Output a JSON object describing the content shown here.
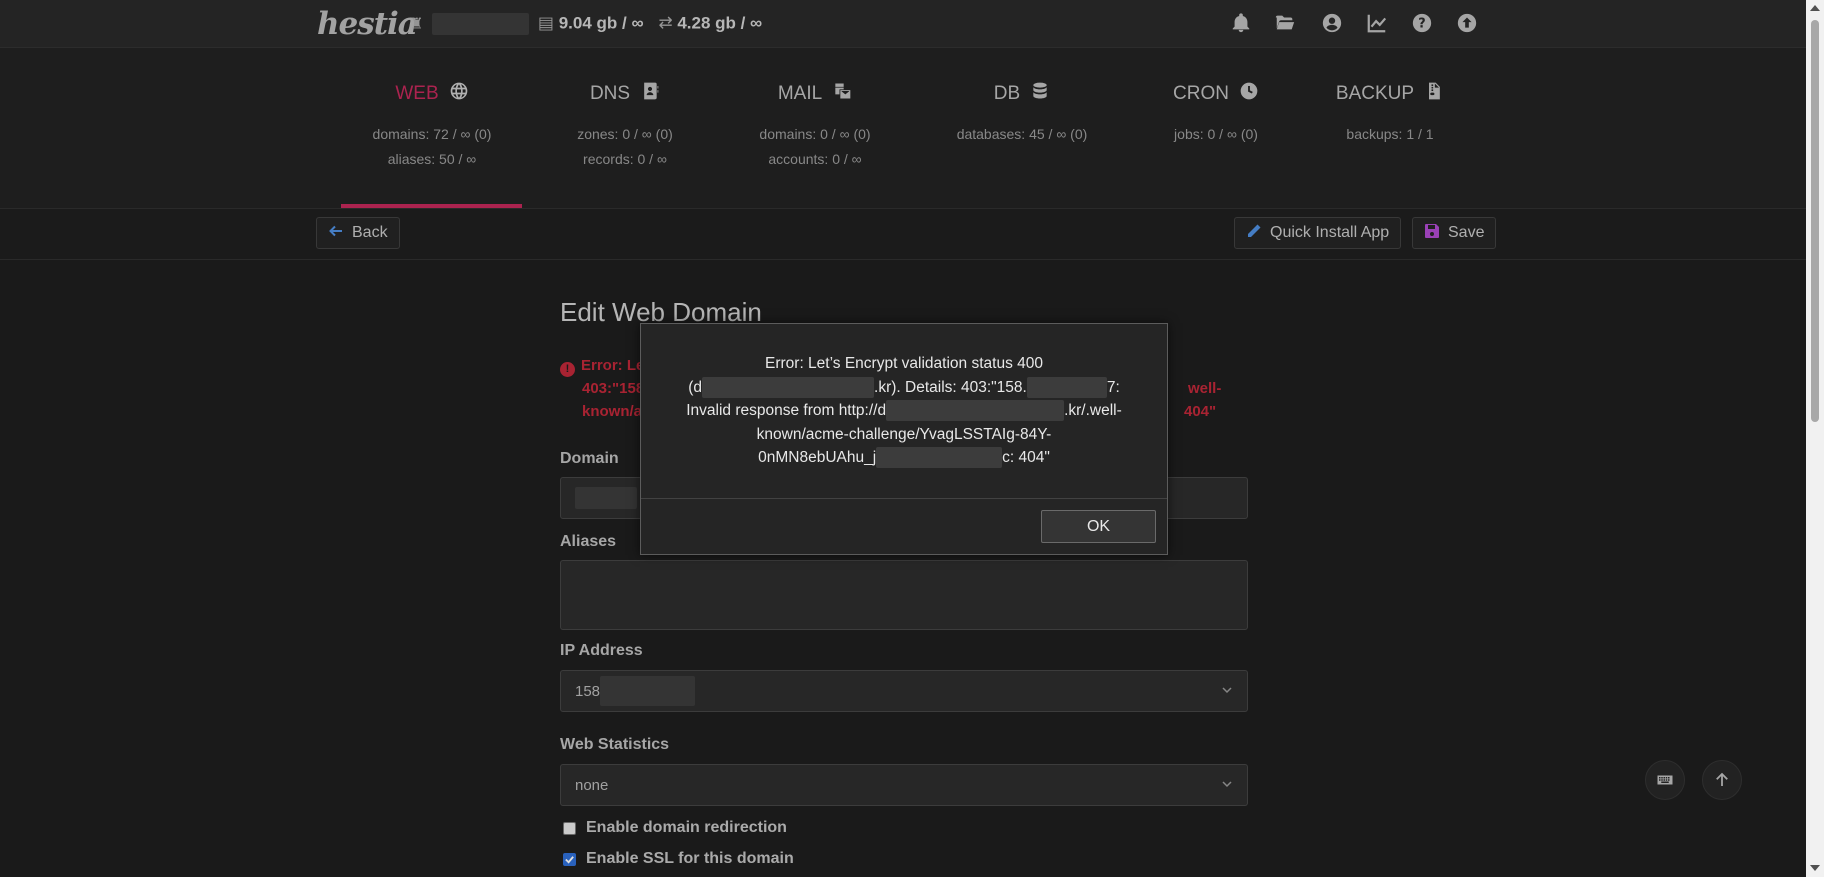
{
  "topbar": {
    "logo": "hestia",
    "disk_usage": "9.04 gb / ∞",
    "bandwidth_usage": "4.28 gb / ∞",
    "icons": [
      "bell-icon",
      "folder-open-icon",
      "user-circle-icon",
      "chart-line-icon",
      "help-icon",
      "upload-icon"
    ]
  },
  "panels": [
    {
      "title": "WEB",
      "icon": "globe-icon",
      "stats": [
        "domains: 72 / ∞ (0)",
        "aliases: 50 / ∞"
      ],
      "active": true
    },
    {
      "title": "DNS",
      "icon": "address-book-icon",
      "stats": [
        "zones: 0 / ∞ (0)",
        "records: 0 / ∞"
      ],
      "active": false
    },
    {
      "title": "MAIL",
      "icon": "mail-bulk-icon",
      "stats": [
        "domains: 0 / ∞ (0)",
        "accounts: 0 / ∞"
      ],
      "active": false
    },
    {
      "title": "DB",
      "icon": "database-icon",
      "stats": [
        "databases: 45 / ∞ (0)"
      ],
      "active": false
    },
    {
      "title": "CRON",
      "icon": "clock-icon",
      "stats": [
        "jobs: 0 / ∞ (0)"
      ],
      "active": false
    },
    {
      "title": "BACKUP",
      "icon": "file-archive-icon",
      "stats": [
        "backups: 1 / 1"
      ],
      "active": false
    }
  ],
  "actions": {
    "back_label": "Back",
    "quick_install_label": "Quick Install App",
    "save_label": "Save"
  },
  "form": {
    "title": "Edit Web Domain",
    "error_lines": [
      "Error: Le",
      "403:\"158",
      "known/a"
    ],
    "error_tail_lines": [
      "well-",
      "404\""
    ],
    "domain_label": "Domain",
    "aliases_label": "Aliases",
    "ip_label": "IP Address",
    "ip_value": "158",
    "stats_label": "Web Statistics",
    "stats_value": "none",
    "redirect_label": "Enable domain redirection",
    "redirect_checked": false,
    "ssl_label": "Enable SSL for this domain",
    "ssl_checked": true
  },
  "modal": {
    "line1": "Error: Let’s Encrypt validation status 400",
    "line2_start": "(d",
    "line2_mid": ".kr). Details: 403:\"158.",
    "line2_end": "7:",
    "line3_start": "Invalid response from http://d",
    "line3_end": ".kr/.well-",
    "line4": "known/acme-challenge/YvagLSSTAIg-84Y-",
    "line5_start": "0nMN8ebUAhu_j",
    "line5_end": "c: 404\"",
    "ok_label": "OK"
  },
  "floating": {
    "keyboard_icon": "keyboard-icon",
    "scroll_top_icon": "arrow-up-icon"
  }
}
